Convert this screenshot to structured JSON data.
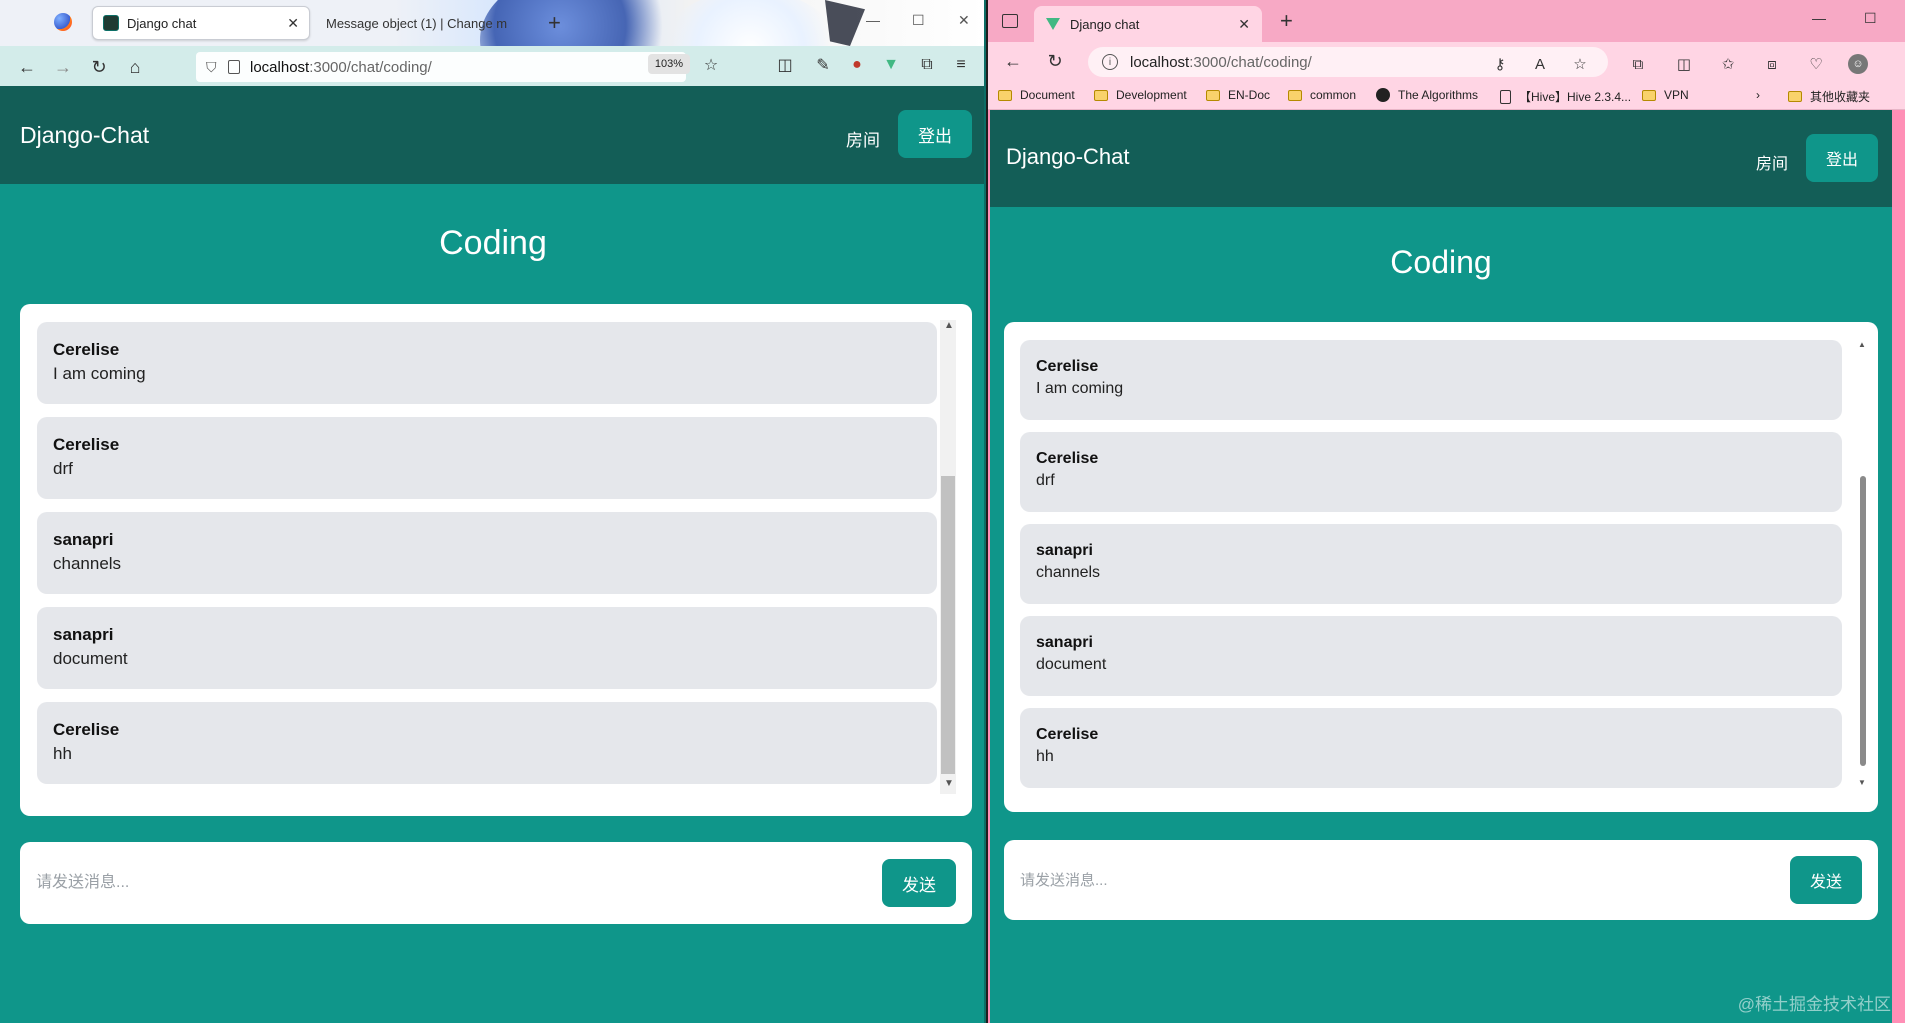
{
  "left": {
    "browser": {
      "tabs": [
        {
          "label": "Django chat",
          "active": true
        },
        {
          "label": "Message object (1) | Change m",
          "active": false
        }
      ],
      "url_host": "localhost",
      "url_path": ":3000/chat/coding/",
      "zoom": "103%"
    },
    "app": {
      "brand": "Django-Chat",
      "nav_room": "房间",
      "logout": "登出",
      "room_title": "Coding",
      "messages": [
        {
          "author": "Cerelise",
          "text": "I am coming"
        },
        {
          "author": "Cerelise",
          "text": "drf"
        },
        {
          "author": "sanapri",
          "text": "channels"
        },
        {
          "author": "sanapri",
          "text": "document"
        },
        {
          "author": "Cerelise",
          "text": "hh"
        }
      ],
      "input_placeholder": "请发送消息...",
      "send_label": "发送"
    }
  },
  "right": {
    "browser": {
      "tabs": [
        {
          "label": "Django chat",
          "active": true
        }
      ],
      "url_host": "localhost",
      "url_path": ":3000/chat/coding/",
      "bookmarks": [
        "Document",
        "Development",
        "EN-Doc",
        "common",
        "The Algorithms",
        "【Hive】Hive 2.3.4...",
        "VPN",
        "其他收藏夹"
      ]
    },
    "app": {
      "brand": "Django-Chat",
      "nav_room": "房间",
      "logout": "登出",
      "room_title": "Coding",
      "messages": [
        {
          "author": "Cerelise",
          "text": "I am coming"
        },
        {
          "author": "Cerelise",
          "text": "drf"
        },
        {
          "author": "sanapri",
          "text": "channels"
        },
        {
          "author": "sanapri",
          "text": "document"
        },
        {
          "author": "Cerelise",
          "text": "hh"
        }
      ],
      "input_placeholder": "请发送消息...",
      "send_label": "发送"
    }
  },
  "watermark": "@稀土掘金技术社区",
  "colors": {
    "header": "#135e57",
    "page_bg": "#0f968a",
    "bubble": "#e5e7eb",
    "edge_chrome": "#ffd5e4",
    "edge_frame": "#ff8fb6"
  }
}
